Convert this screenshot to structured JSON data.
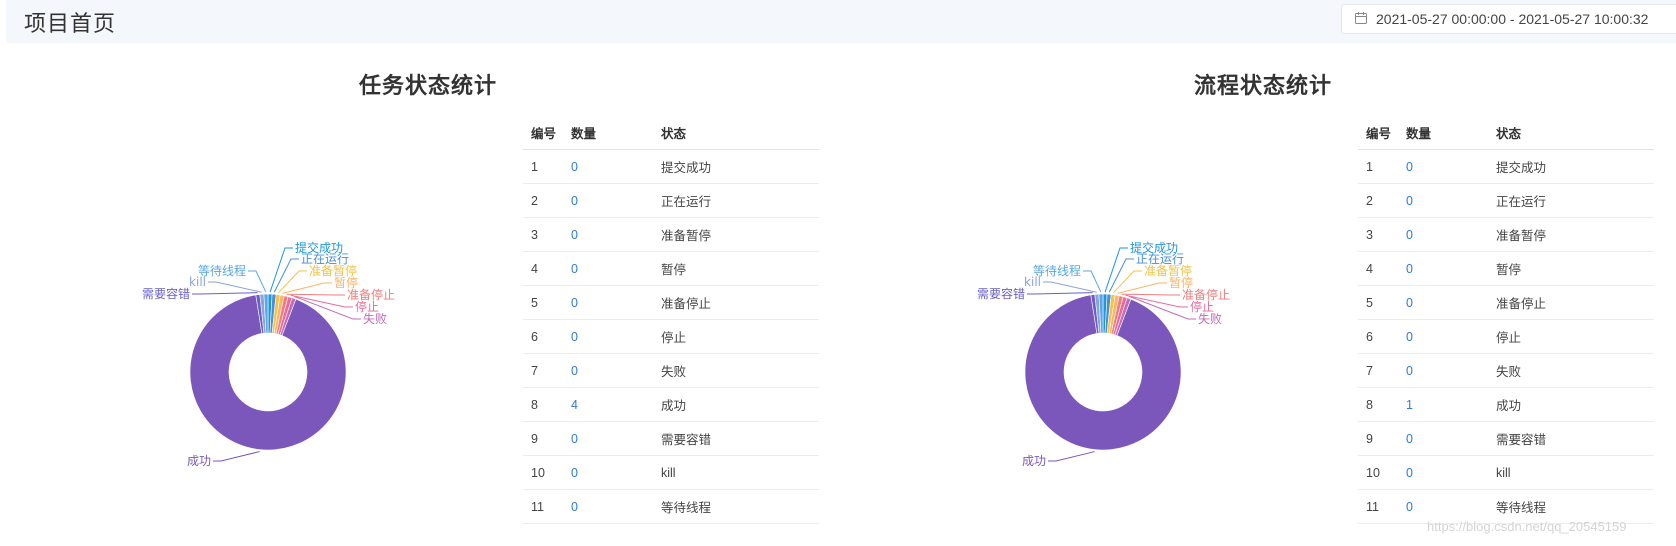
{
  "header": {
    "title": "项目首页",
    "date_range": "2021-05-27 00:00:00 - 2021-05-27 10:00:32",
    "date_icon": "calendar-icon"
  },
  "table_headers": [
    "编号",
    "数量",
    "状态"
  ],
  "task_section": {
    "title": "任务状态统计",
    "rows": [
      {
        "id": "1",
        "count": "0",
        "status": "提交成功"
      },
      {
        "id": "2",
        "count": "0",
        "status": "正在运行"
      },
      {
        "id": "3",
        "count": "0",
        "status": "准备暂停"
      },
      {
        "id": "4",
        "count": "0",
        "status": "暂停"
      },
      {
        "id": "5",
        "count": "0",
        "status": "准备停止"
      },
      {
        "id": "6",
        "count": "0",
        "status": "停止"
      },
      {
        "id": "7",
        "count": "0",
        "status": "失败"
      },
      {
        "id": "8",
        "count": "4",
        "status": "成功"
      },
      {
        "id": "9",
        "count": "0",
        "status": "需要容错"
      },
      {
        "id": "10",
        "count": "0",
        "status": "kill"
      },
      {
        "id": "11",
        "count": "0",
        "status": "等待线程"
      }
    ]
  },
  "process_section": {
    "title": "流程状态统计",
    "rows": [
      {
        "id": "1",
        "count": "0",
        "status": "提交成功"
      },
      {
        "id": "2",
        "count": "0",
        "status": "正在运行"
      },
      {
        "id": "3",
        "count": "0",
        "status": "准备暂停"
      },
      {
        "id": "4",
        "count": "0",
        "status": "暂停"
      },
      {
        "id": "5",
        "count": "0",
        "status": "准备停止"
      },
      {
        "id": "6",
        "count": "0",
        "status": "停止"
      },
      {
        "id": "7",
        "count": "0",
        "status": "失败"
      },
      {
        "id": "8",
        "count": "1",
        "status": "成功"
      },
      {
        "id": "9",
        "count": "0",
        "status": "需要容错"
      },
      {
        "id": "10",
        "count": "0",
        "status": "kill"
      },
      {
        "id": "11",
        "count": "0",
        "status": "等待线程"
      }
    ]
  },
  "chart_data": [
    {
      "type": "pie",
      "style": "donut",
      "title": "任务状态统计",
      "categories": [
        "提交成功",
        "正在运行",
        "准备暂停",
        "暂停",
        "准备停止",
        "停止",
        "失败",
        "成功",
        "需要容错",
        "kill",
        "等待线程"
      ],
      "values": [
        0,
        0,
        0,
        0,
        0,
        0,
        0,
        4,
        0,
        0,
        0
      ],
      "colors": [
        "#1e96de",
        "#4a8fd6",
        "#f5c342",
        "#fbb468",
        "#f27d7d",
        "#ea6a9a",
        "#c36cb8",
        "#7b57bc",
        "#6a5fc8",
        "#8aa3dc",
        "#58a7e6"
      ]
    },
    {
      "type": "pie",
      "style": "donut",
      "title": "流程状态统计",
      "categories": [
        "提交成功",
        "正在运行",
        "准备暂停",
        "暂停",
        "准备停止",
        "停止",
        "失败",
        "成功",
        "需要容错",
        "kill",
        "等待线程"
      ],
      "values": [
        0,
        0,
        0,
        0,
        0,
        0,
        0,
        1,
        0,
        0,
        0
      ],
      "colors": [
        "#1e96de",
        "#4a8fd6",
        "#f5c342",
        "#fbb468",
        "#f27d7d",
        "#ea6a9a",
        "#c36cb8",
        "#7b57bc",
        "#6a5fc8",
        "#8aa3dc",
        "#58a7e6"
      ]
    }
  ],
  "watermark": "https://blog.csdn.net/qq_20545159"
}
